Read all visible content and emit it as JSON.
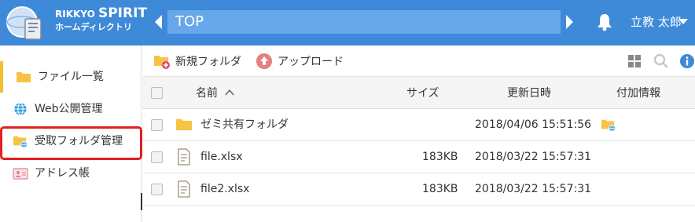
{
  "app": {
    "brand_line1_prefix": "RIKKYO ",
    "brand_line1_main": "SPIRIT",
    "brand_line2": "ホームディレクトリ"
  },
  "header": {
    "breadcrumb": "TOP",
    "user_name": "立教 太郎",
    "background_color": "#3e89d8"
  },
  "sidebar": {
    "items": [
      {
        "label": "ファイル一覧",
        "icon": "folder-icon",
        "active": true
      },
      {
        "label": "Web公開管理",
        "icon": "globe-icon",
        "active": false
      },
      {
        "label": "受取フォルダ管理",
        "icon": "shared-folder-icon",
        "active": false,
        "highlighted": true
      },
      {
        "label": "アドレス帳",
        "icon": "address-book-icon",
        "active": false
      }
    ]
  },
  "toolbar": {
    "new_folder_label": "新規フォルダ",
    "upload_label": "アップロード",
    "icons": [
      "grid-view-icon",
      "search-icon",
      "info-icon"
    ]
  },
  "table": {
    "columns": {
      "name": "名前",
      "size": "サイズ",
      "modified": "更新日時",
      "info": "付加情報"
    },
    "rows": [
      {
        "type": "folder",
        "name": "ゼミ共有フォルダ",
        "size": "",
        "modified": "2018/04/06 15:51:56",
        "has_info_icon": true
      },
      {
        "type": "file",
        "name": "file.xlsx",
        "size": "183KB",
        "modified": "2018/03/22 15:57:31",
        "has_info_icon": false
      },
      {
        "type": "file",
        "name": "file2.xlsx",
        "size": "183KB",
        "modified": "2018/03/22 15:57:31",
        "has_info_icon": false
      }
    ]
  }
}
